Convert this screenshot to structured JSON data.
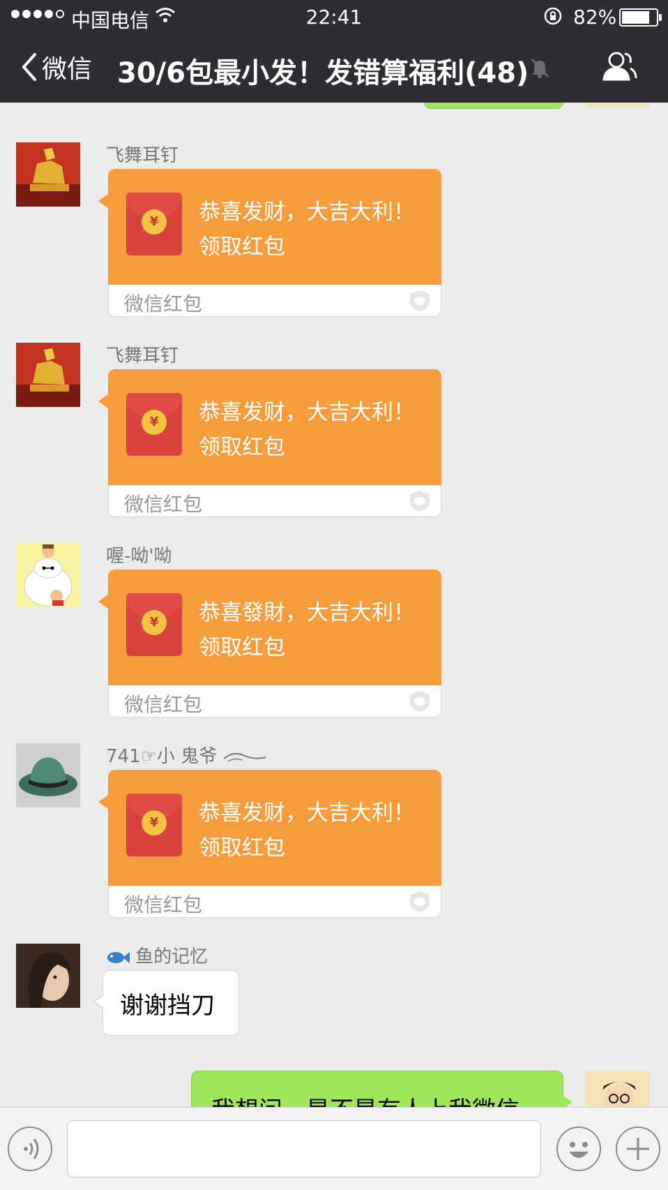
{
  "status_bar": {
    "carrier": "中国电信",
    "time": "22:41",
    "battery": "82%",
    "battery_level": 0.82
  },
  "nav": {
    "back_label": "微信",
    "title": "30/6包最小发！发错算福利(48)"
  },
  "messages": [
    {
      "sender": "飞舞耳钉",
      "type": "red_packet",
      "greeting": "恭喜发财，大吉大利！",
      "action": "领取红包",
      "footer": "微信红包"
    },
    {
      "sender": "飞舞耳钉",
      "type": "red_packet",
      "greeting": "恭喜发财，大吉大利！",
      "action": "领取红包",
      "footer": "微信红包"
    },
    {
      "sender": "喔-呦'呦",
      "type": "red_packet",
      "greeting": "恭喜發財，大吉大利！",
      "action": "领取红包",
      "footer": "微信红包"
    },
    {
      "sender": "741☞小 鬼爷",
      "type": "red_packet",
      "greeting": "恭喜发财，大吉大利！",
      "action": "领取红包",
      "footer": "微信红包"
    },
    {
      "sender": "鱼的记忆",
      "type": "text",
      "text": "谢谢挡刀"
    },
    {
      "sender": "",
      "type": "outgoing_text",
      "text": "我想问，是不是有人上我微信"
    }
  ],
  "input": {
    "placeholder": "",
    "value": ""
  },
  "colors": {
    "nav_bg": "#2d2e33",
    "chat_bg": "#ebebeb",
    "red_packet": "#f79c3c",
    "outgoing_bubble": "#9fe65a"
  }
}
